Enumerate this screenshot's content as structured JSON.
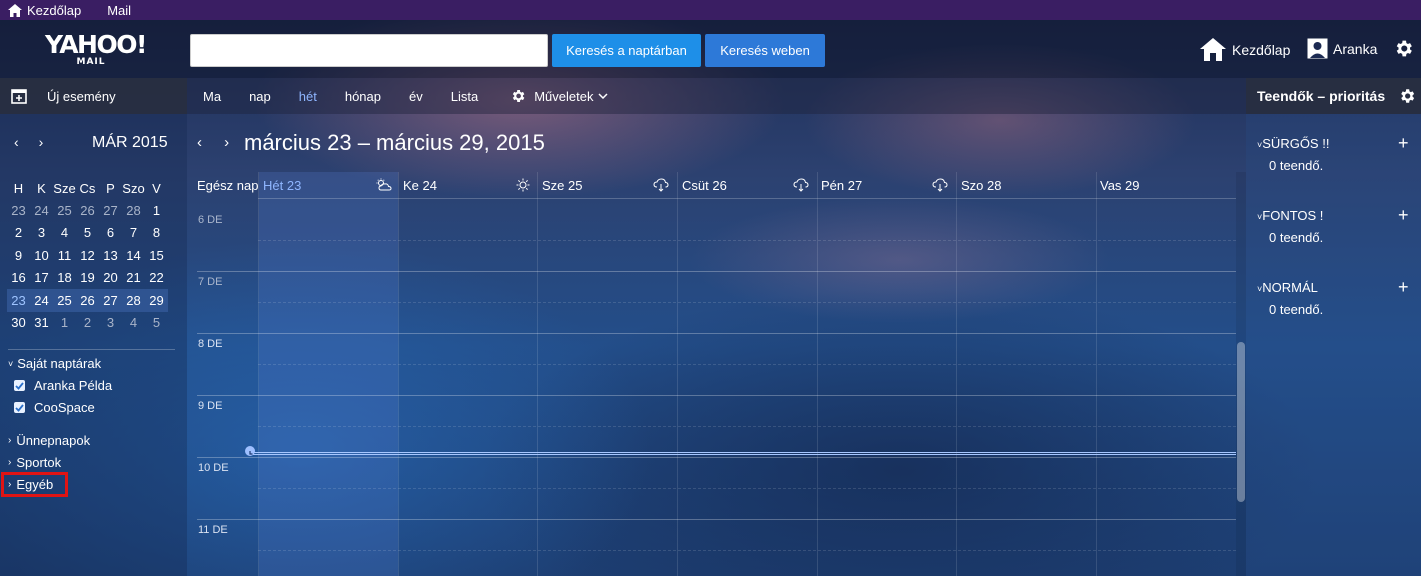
{
  "topbar": {
    "home": "Kezdőlap",
    "mail": "Mail"
  },
  "header": {
    "logo_main": "YAHOO!",
    "logo_sub": "MAIL",
    "search_value": "",
    "btn_search_calendar": "Keresés a naptárban",
    "btn_search_web": "Keresés weben",
    "home": "Kezdőlap",
    "user": "Aranka"
  },
  "toolbar": {
    "new_event": "Új esemény",
    "views": [
      "Ma",
      "nap",
      "hét",
      "hónap",
      "év",
      "Lista"
    ],
    "active_view": "hét",
    "actions": "Műveletek"
  },
  "mini_calendar": {
    "title": "MÁR 2015",
    "weekdays": [
      "H",
      "K",
      "Sze",
      "Cs",
      "P",
      "Szo",
      "V"
    ],
    "weeks": [
      [
        "23",
        "24",
        "25",
        "26",
        "27",
        "28",
        "1"
      ],
      [
        "2",
        "3",
        "4",
        "5",
        "6",
        "7",
        "8"
      ],
      [
        "9",
        "10",
        "11",
        "12",
        "13",
        "14",
        "15"
      ],
      [
        "16",
        "17",
        "18",
        "19",
        "20",
        "21",
        "22"
      ],
      [
        "23",
        "24",
        "25",
        "26",
        "27",
        "28",
        "29"
      ],
      [
        "30",
        "31",
        "1",
        "2",
        "3",
        "4",
        "5"
      ]
    ]
  },
  "calendars": {
    "own_title": "Saját naptárak",
    "own": [
      "Aranka Példa",
      "CooSpace"
    ],
    "groups": [
      "Ünnepnapok",
      "Sportok",
      "Egyéb"
    ]
  },
  "calendar": {
    "range_title": "március 23 – március 29, 2015",
    "all_day": "Egész nap",
    "days": [
      "Hét 23",
      "Ke 24",
      "Sze 25",
      "Csüt 26",
      "Pén 27",
      "Szo 28",
      "Vas 29"
    ],
    "weather_icons": [
      "partly-cloudy-icon",
      "sun-icon",
      "rain-cloud-icon",
      "rain-cloud-icon",
      "rain-cloud-icon",
      "",
      ""
    ],
    "hours": [
      "6 DE",
      "7 DE",
      "8 DE",
      "9 DE",
      "10 DE",
      "11 DE"
    ]
  },
  "tasks": {
    "title": "Teendők – prioritás",
    "groups": [
      {
        "name": "SÜRGŐS !!",
        "count": "0 teendő."
      },
      {
        "name": "FONTOS !",
        "count": "0 teendő."
      },
      {
        "name": "NORMÁL",
        "count": "0 teendő."
      }
    ]
  },
  "colors": {
    "accent": "#1e8fe8",
    "topbar": "#3a1e63",
    "highlight": "#e01414"
  }
}
